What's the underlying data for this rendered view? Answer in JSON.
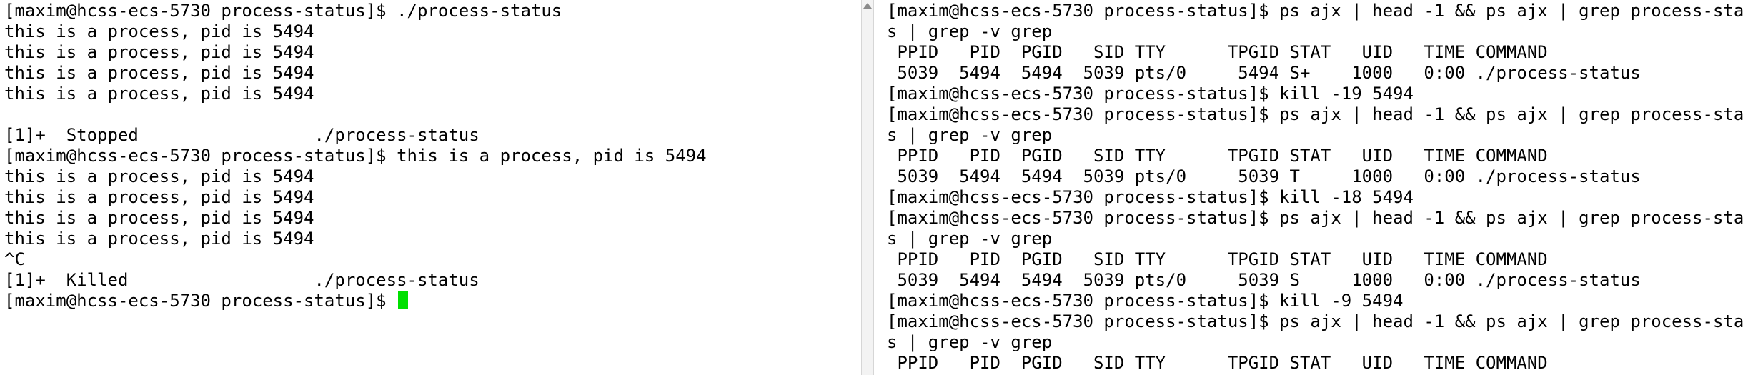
{
  "left_terminal": {
    "lines": [
      "[maxim@hcss-ecs-5730 process-status]$ ./process-status",
      "this is a process, pid is 5494",
      "this is a process, pid is 5494",
      "this is a process, pid is 5494",
      "this is a process, pid is 5494",
      "",
      "[1]+  Stopped                 ./process-status",
      "[maxim@hcss-ecs-5730 process-status]$ this is a process, pid is 5494",
      "this is a process, pid is 5494",
      "this is a process, pid is 5494",
      "this is a process, pid is 5494",
      "this is a process, pid is 5494",
      "^C",
      "[1]+  Killed                  ./process-status"
    ],
    "prompt": "[maxim@hcss-ecs-5730 process-status]$ ",
    "cursor_color": "#00e000"
  },
  "right_terminal": {
    "lines": [
      "[maxim@hcss-ecs-5730 process-status]$ ps ajx | head -1 && ps ajx | grep process-statu",
      "s | grep -v grep",
      " PPID   PID  PGID   SID TTY      TPGID STAT   UID   TIME COMMAND",
      " 5039  5494  5494  5039 pts/0     5494 S+    1000   0:00 ./process-status",
      "[maxim@hcss-ecs-5730 process-status]$ kill -19 5494",
      "[maxim@hcss-ecs-5730 process-status]$ ps ajx | head -1 && ps ajx | grep process-statu",
      "s | grep -v grep",
      " PPID   PID  PGID   SID TTY      TPGID STAT   UID   TIME COMMAND",
      " 5039  5494  5494  5039 pts/0     5039 T     1000   0:00 ./process-status",
      "[maxim@hcss-ecs-5730 process-status]$ kill -18 5494",
      "[maxim@hcss-ecs-5730 process-status]$ ps ajx | head -1 && ps ajx | grep process-statu",
      "s | grep -v grep",
      " PPID   PID  PGID   SID TTY      TPGID STAT   UID   TIME COMMAND",
      " 5039  5494  5494  5039 pts/0     5039 S     1000   0:00 ./process-status",
      "[maxim@hcss-ecs-5730 process-status]$ kill -9 5494",
      "[maxim@hcss-ecs-5730 process-status]$ ps ajx | head -1 && ps ajx | grep process-statu",
      "s | grep -v grep",
      " PPID   PID  PGID   SID TTY      TPGID STAT   UID   TIME COMMAND"
    ]
  }
}
